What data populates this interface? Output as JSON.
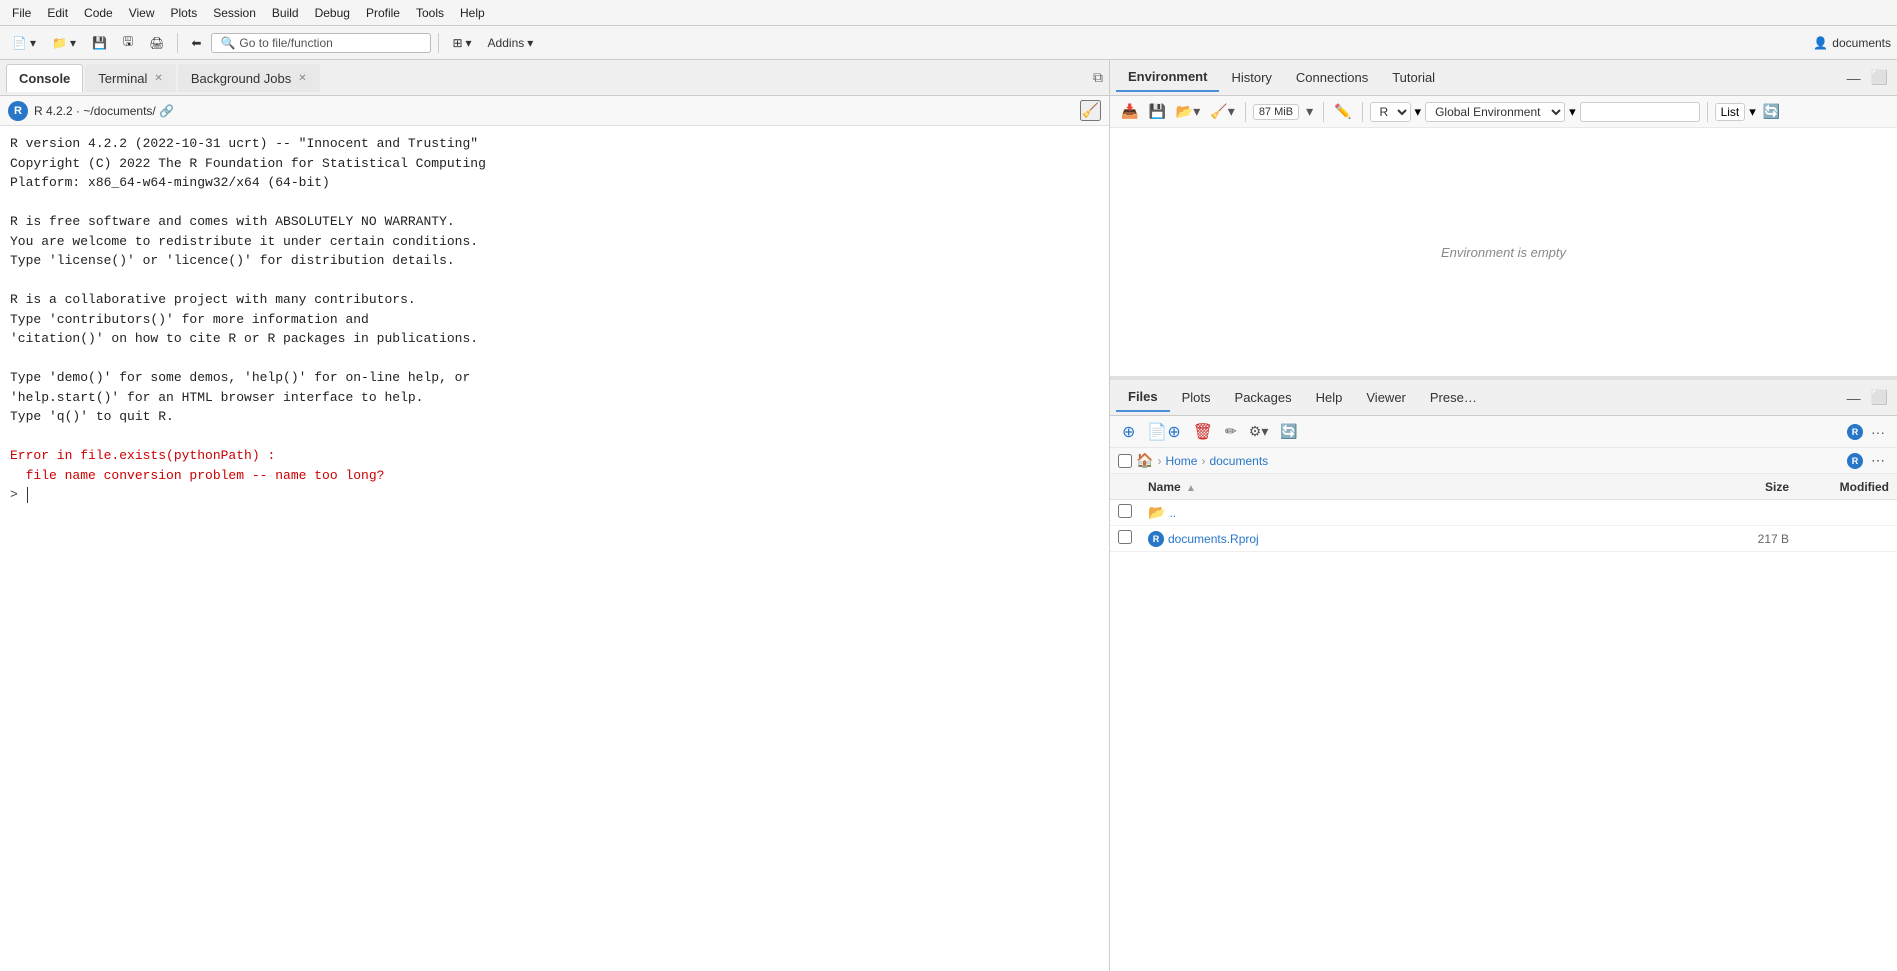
{
  "menubar": {
    "items": [
      "File",
      "Edit",
      "Code",
      "View",
      "Plots",
      "Session",
      "Build",
      "Debug",
      "Profile",
      "Tools",
      "Help"
    ]
  },
  "toolbar": {
    "goto_placeholder": "Go to file/function",
    "addins_label": "Addins",
    "user_label": "documents"
  },
  "left_panel": {
    "tabs": [
      {
        "label": "Console",
        "closable": false,
        "active": true
      },
      {
        "label": "Terminal",
        "closable": true,
        "active": false
      },
      {
        "label": "Background Jobs",
        "closable": true,
        "active": false
      }
    ],
    "console_header": {
      "r_version": "R 4.2.2",
      "path": "~/documents/",
      "version_label": "R"
    },
    "console_output": [
      "R version 4.2.2 (2022-10-31 ucrt) -- \"Innocent and Trusting\"",
      "Copyright (C) 2022 The R Foundation for Statistical Computing",
      "Platform: x86_64-w64-mingw32/x64 (64-bit)",
      "",
      "R is free software and comes with ABSOLUTELY NO WARRANTY.",
      "You are welcome to redistribute it under certain conditions.",
      "Type 'license()' or 'licence()' for distribution details.",
      "",
      "R is a collaborative project with many contributors.",
      "Type 'contributors()' for more information and",
      "'citation()' on how to cite R or R packages in publications.",
      "",
      "Type 'demo()' for some demos, 'help()' for on-line help, or",
      "'help.start()' for an HTML browser interface to help.",
      "Type 'q()' to quit R."
    ],
    "error_lines": [
      "Error in file.exists(pythonPath) :",
      "  file name conversion problem -- name too long?"
    ],
    "prompt": ">"
  },
  "right_top": {
    "tabs": [
      {
        "label": "Environment",
        "active": true
      },
      {
        "label": "History",
        "active": false
      },
      {
        "label": "Connections",
        "active": false
      },
      {
        "label": "Tutorial",
        "active": false
      }
    ],
    "memory": "87 MiB",
    "r_selector": "R",
    "env_selector": "Global Environment",
    "list_label": "List",
    "env_empty_msg": "Environment is empty"
  },
  "right_bottom": {
    "tabs": [
      {
        "label": "Files",
        "active": true
      },
      {
        "label": "Plots",
        "active": false
      },
      {
        "label": "Packages",
        "active": false
      },
      {
        "label": "Help",
        "active": false
      },
      {
        "label": "Viewer",
        "active": false
      },
      {
        "label": "Prese…",
        "active": false
      }
    ],
    "breadcrumb": [
      "Home",
      "documents"
    ],
    "columns": [
      {
        "label": "Name",
        "sort": true
      },
      {
        "label": "Size",
        "sort": false
      },
      {
        "label": "Modified",
        "sort": false
      }
    ],
    "files": [
      {
        "type": "folder",
        "name": "..",
        "size": "",
        "modified": ""
      },
      {
        "type": "rproj",
        "name": "documents.Rproj",
        "size": "217 B",
        "modified": ""
      }
    ]
  }
}
